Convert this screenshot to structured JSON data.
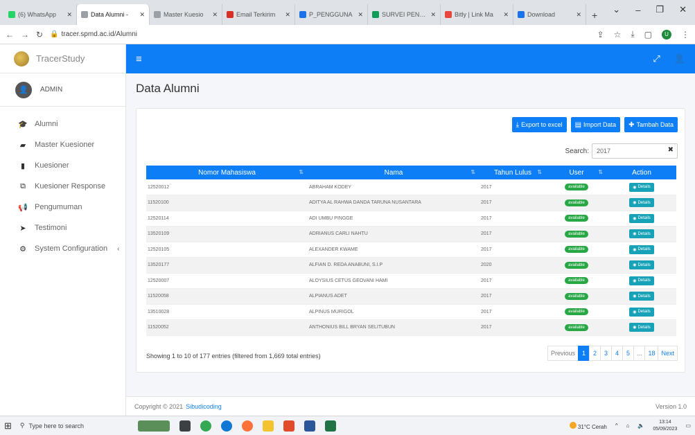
{
  "browser": {
    "tabs": [
      {
        "icon_color": "#25d366",
        "label": "(6) WhatsApp",
        "active": false
      },
      {
        "icon_color": "#9aa0a6",
        "label": "Data Alumni -",
        "active": true
      },
      {
        "icon_color": "#9aa0a6",
        "label": "Master Kuesio",
        "active": false
      },
      {
        "icon_color": "#d93025",
        "label": "Email Terkirim",
        "active": false
      },
      {
        "icon_color": "#1a73e8",
        "label": "P_PENGGUNA",
        "active": false
      },
      {
        "icon_color": "#0f9d58",
        "label": "SURVEI PENGG",
        "active": false
      },
      {
        "icon_color": "#e8453c",
        "label": "Bitly | Link Ma",
        "active": false
      },
      {
        "icon_color": "#1a73e8",
        "label": "Download",
        "active": false
      }
    ],
    "url": "tracer.spmd.ac.id/Alumni"
  },
  "sidebar": {
    "brand": "TracerStudy",
    "user": "ADMIN",
    "items": [
      {
        "label": "Alumni",
        "icon": "graduation-cap-icon",
        "glyph": "🎓"
      },
      {
        "label": "Master Kuesioner",
        "icon": "folder-icon",
        "glyph": "▰"
      },
      {
        "label": "Kuesioner",
        "icon": "book-icon",
        "glyph": "▮"
      },
      {
        "label": "Kuesioner Response",
        "icon": "copy-icon",
        "glyph": "⧉"
      },
      {
        "label": "Pengumuman",
        "icon": "bullhorn-icon",
        "glyph": "📢"
      },
      {
        "label": "Testimoni",
        "icon": "paper-plane-icon",
        "glyph": "➤"
      },
      {
        "label": "System Configuration",
        "icon": "cogs-icon",
        "glyph": "⚙"
      }
    ]
  },
  "page": {
    "title": "Data Alumni",
    "buttons": {
      "export": "Export to excel",
      "import": "Import Data",
      "add": "Tambah Data"
    },
    "search_label": "Search:",
    "search_value": "2017",
    "columns": [
      "Nomor Mahasiswa",
      "Nama",
      "Tahun Lulus",
      "User",
      "Action"
    ],
    "rows": [
      {
        "nim": "12520012",
        "nama": "ABRAHAM KODEY",
        "tahun": "2017",
        "user": "available",
        "action": "Details"
      },
      {
        "nim": "11520100",
        "nama": "ADITYA AL RAHWA DANDA TARUNA NUSANTARA",
        "tahun": "2017",
        "user": "available",
        "action": "Details"
      },
      {
        "nim": "12520114",
        "nama": "ADI UMBU PINGGE",
        "tahun": "2017",
        "user": "available",
        "action": "Details"
      },
      {
        "nim": "13520109",
        "nama": "ADRIANUS CARLI NAHTU",
        "tahun": "2017",
        "user": "available",
        "action": "Details"
      },
      {
        "nim": "12520105",
        "nama": "ALEXANDER KWAME",
        "tahun": "2017",
        "user": "available",
        "action": "Details"
      },
      {
        "nim": "13520177",
        "nama": "ALFIAN D. REDA ANABUNI, S.I.P",
        "tahun": "2020",
        "user": "available",
        "action": "Details"
      },
      {
        "nim": "12520007",
        "nama": "ALOYSIUS CETUS GEOVANI HAMI",
        "tahun": "2017",
        "user": "available",
        "action": "Details"
      },
      {
        "nim": "11520058",
        "nama": "ALPIANUS ADET",
        "tahun": "2017",
        "user": "available",
        "action": "Details"
      },
      {
        "nim": "13510028",
        "nama": "ALPINUS MURIGOL",
        "tahun": "2017",
        "user": "available",
        "action": "Details"
      },
      {
        "nim": "11520052",
        "nama": "ANTHONIUS BILL BRYAN SELITUBUN",
        "tahun": "2017",
        "user": "available",
        "action": "Details"
      }
    ],
    "info": "Showing 1 to 10 of 177 entries (filtered from 1,669 total entries)",
    "pagination": [
      "Previous",
      "1",
      "2",
      "3",
      "4",
      "5",
      "...",
      "18",
      "Next"
    ]
  },
  "footer": {
    "copyright": "Copyright © 2021",
    "link": "Sibudicoding",
    "version": "Version 1.0"
  },
  "taskbar": {
    "search_placeholder": "Type here to search",
    "weather": "31°C Cerah",
    "time": "13:14",
    "date": "05/09/2023"
  },
  "colors": {
    "primary": "#0d7ef6",
    "badge": "#28a745",
    "details": "#17a2b8"
  }
}
